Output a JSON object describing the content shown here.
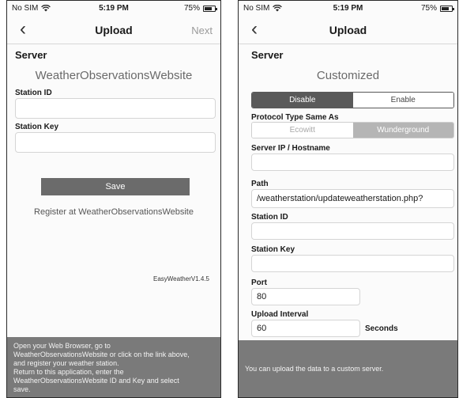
{
  "left": {
    "status": {
      "carrier": "No SIM",
      "time": "5:19 PM",
      "battery": "75%",
      "battery_level": 0.75
    },
    "nav": {
      "title": "Upload",
      "next": "Next"
    },
    "server_label": "Server",
    "server_name": "WeatherObservationsWebsite",
    "station_id_label": "Station ID",
    "station_id_value": "",
    "station_key_label": "Station Key",
    "station_key_value": "",
    "save_label": "Save",
    "register_link": "Register at WeatherObservationsWebsite",
    "version": "EasyWeatherV1.4.5",
    "footer_lines": [
      "Open your Web Browser, go to",
      "WeatherObservationsWebsite or click on the link above,",
      "and register your weather station.",
      "Return to this application, enter the",
      "WeatherObservationsWebsite ID and Key and select",
      "save."
    ]
  },
  "right": {
    "status": {
      "carrier": "No SIM",
      "time": "5:19 PM",
      "battery": "75%",
      "battery_level": 0.75
    },
    "nav": {
      "title": "Upload"
    },
    "server_label": "Server",
    "server_name": "Customized",
    "toggle": {
      "disable": "Disable",
      "enable": "Enable",
      "selected": "Disable"
    },
    "protocol_label": "Protocol Type Same As",
    "protocol": {
      "ecowitt": "Ecowitt",
      "wunderground": "Wunderground",
      "selected": "Wunderground"
    },
    "host_label": "Server IP / Hostname",
    "host_value": "",
    "path_label": "Path",
    "path_value": "/weatherstation/updateweatherstation.php?",
    "station_id_label": "Station ID",
    "station_id_value": "",
    "station_key_label": "Station Key",
    "station_key_value": "",
    "port_label": "Port",
    "port_value": "80",
    "interval_label": "Upload Interval",
    "interval_value": "60",
    "interval_unit": "Seconds",
    "footer_text": "You can upload the data to a custom server."
  },
  "colors": {
    "dark_gray": "#5a5a5a",
    "footer_gray": "#7a7a7a",
    "muted_text": "#6a6a6a"
  },
  "icons": {
    "wifi": "wifi-icon",
    "back": "chevron-left-icon",
    "battery": "battery-icon"
  }
}
